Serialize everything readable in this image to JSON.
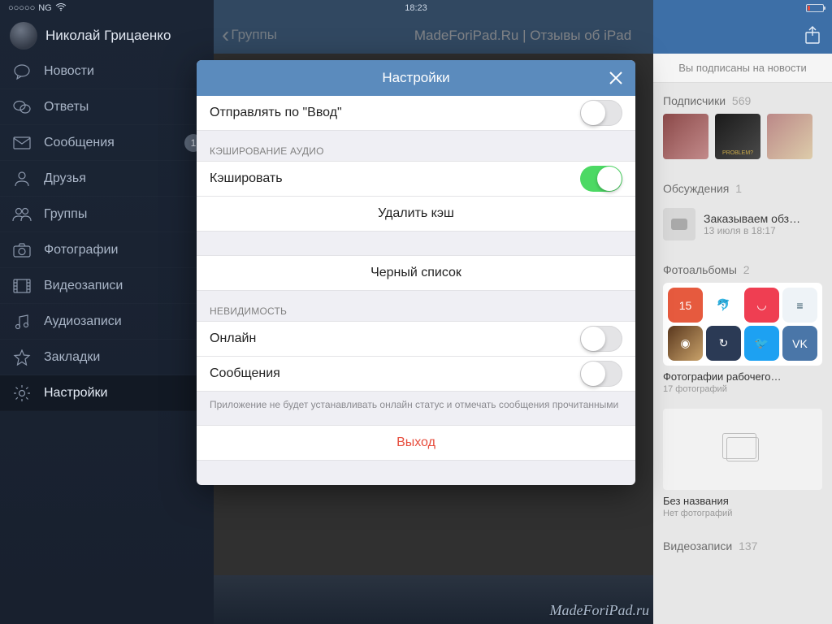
{
  "status": {
    "dots": "○○○○○",
    "carrier": "NG",
    "time": "18:23"
  },
  "profile": {
    "name": "Николай Грицаенко"
  },
  "sidebar": [
    {
      "icon": "bubble",
      "label": "Новости",
      "badge": null
    },
    {
      "icon": "bubbles",
      "label": "Ответы",
      "badge": null
    },
    {
      "icon": "mail",
      "label": "Сообщения",
      "badge": "1"
    },
    {
      "icon": "person",
      "label": "Друзья",
      "badge": null
    },
    {
      "icon": "people",
      "label": "Группы",
      "badge": null
    },
    {
      "icon": "camera",
      "label": "Фотографии",
      "badge": null
    },
    {
      "icon": "film",
      "label": "Видеозаписи",
      "badge": null
    },
    {
      "icon": "music",
      "label": "Аудиозаписи",
      "badge": null
    },
    {
      "icon": "star",
      "label": "Закладки",
      "badge": null
    },
    {
      "icon": "gear",
      "label": "Настройки",
      "badge": null,
      "active": true
    }
  ],
  "nav": {
    "back": "Группы",
    "title": "MadeForiPad.Ru | Отзывы об iPad"
  },
  "right": {
    "subscribed": "Вы подписаны на новости",
    "subscribers_label": "Подписчики",
    "subscribers_count": "569",
    "discussions_label": "Обсуждения",
    "discussions_count": "1",
    "discussion_title": "Заказываем обз…",
    "discussion_time": "13 июля в 18:17",
    "albums_label": "Фотоальбомы",
    "albums_count": "2",
    "album1_title": "Фотографии рабочего…",
    "album1_sub": "17 фотографий",
    "album2_title": "Без названия",
    "album2_sub": "Нет фотографий",
    "videos_label": "Видеозаписи",
    "videos_count": "137"
  },
  "modal": {
    "title": "Настройки",
    "send_on_enter": "Отправлять по \"Ввод\"",
    "section_cache": "КЭШИРОВАНИЕ АУДИО",
    "cache_enable": "Кэшировать",
    "cache_clear": "Удалить кэш",
    "blacklist": "Черный список",
    "section_invis": "НЕВИДИМОСТЬ",
    "online": "Онлайн",
    "messages": "Сообщения",
    "footnote": "Приложение не будет устанавливать онлайн статус и отмечать сообщения прочитанными",
    "logout": "Выход"
  },
  "watermark": "MadeForiPad.ru",
  "app_tiles": [
    {
      "bg": "#e65a3e",
      "label": "15",
      "cap": "Calendars 5"
    },
    {
      "bg": "#ffffff",
      "label": "🐬",
      "cap": "Dolphin",
      "fg": "#2aa564"
    },
    {
      "bg": "#ef3e52",
      "label": "◡",
      "cap": "Pocket"
    },
    {
      "bg": "#eef3f7",
      "label": "≡",
      "cap": "Newsify",
      "fg": "#356"
    },
    {
      "bg": "linear-gradient(135deg,#5a381e,#c9a26a)",
      "label": "◉",
      "cap": "Instagram"
    },
    {
      "bg": "#2b3a55",
      "label": "↻",
      "cap": "Repost"
    },
    {
      "bg": "#1da1f2",
      "label": "🐦",
      "cap": "Twitter"
    },
    {
      "bg": "#4a76a8",
      "label": "VK",
      "cap": "VK"
    }
  ]
}
